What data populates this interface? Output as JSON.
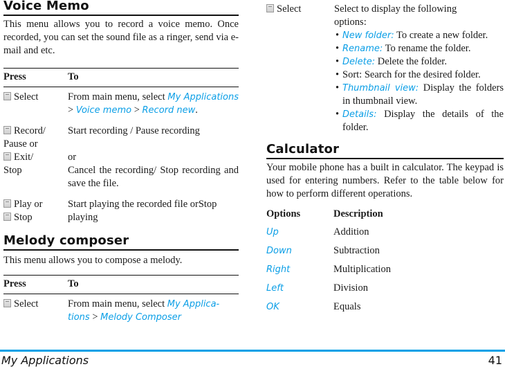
{
  "voice_memo": {
    "title": "Voice Memo",
    "intro": "This menu allows you to record a voice memo. Once recorded, you can set the sound file as a ringer, send via e-mail and etc.",
    "table": {
      "headers": [
        "Press",
        "To"
      ],
      "rows": [
        {
          "press": [
            {
              "key": true,
              "text": "Select"
            }
          ],
          "to": {
            "pre": "From main menu, select ",
            "links": [
              "My Applications",
              "Voice memo",
              "Record new"
            ],
            "sep": " > ",
            "post": "."
          }
        },
        {
          "press_lines": [
            "Record/",
            "Pause or",
            "Exit/",
            "Stop"
          ],
          "to_lines": [
            "Start recording / Pause recording",
            "or",
            "Cancel the recording/ Stop recording and save the file."
          ]
        },
        {
          "press_lines": [
            "Play or",
            "Stop"
          ],
          "to": "Start playing the recorded file orStop playing"
        }
      ]
    }
  },
  "melody_composer": {
    "title": "Melody composer",
    "intro": "This menu allows you to compose a melody.",
    "table": {
      "headers": [
        "Press",
        "To"
      ],
      "rows": [
        {
          "press": "Select",
          "to": {
            "pre": "From main menu, select ",
            "links": [
              "My Applica-tions",
              "Melody Composer"
            ],
            "sep": " > "
          }
        }
      ]
    }
  },
  "folder_options": {
    "press": "Select",
    "intro": "Select to display the following options:",
    "items": [
      {
        "label": "New folder:",
        "text": " To create a new folder.",
        "link": true
      },
      {
        "label": "Rename:",
        "text": " To rename the folder.",
        "link": true
      },
      {
        "label": "Delete:",
        "text": " Delete the folder.",
        "link": true
      },
      {
        "label": "",
        "text": "Sort: Search for the desired folder.",
        "link": false
      },
      {
        "label": "Thumbnail view:",
        "text": " Display the folders in thumbnail view.",
        "link": true
      },
      {
        "label": "Details:",
        "text": " Display the details of the folder.",
        "link": true
      }
    ]
  },
  "calculator": {
    "title": "Calculator",
    "intro": "Your mobile phone has a built in calculator. The keypad is used for entering numbers. Refer to the table below for how to perform different operations.",
    "table": {
      "headers": [
        "Options",
        "Description"
      ],
      "rows": [
        {
          "option": "Up",
          "description": "Addition"
        },
        {
          "option": "Down",
          "description": "Subtraction"
        },
        {
          "option": "Right",
          "description": "Multiplication"
        },
        {
          "option": "Left",
          "description": "Division"
        },
        {
          "option": "OK",
          "description": "Equals"
        }
      ]
    }
  },
  "footer": {
    "section": "My Applications",
    "page_number": "41",
    "accent_color": "#00a0e6"
  },
  "colors": {
    "link": "#0a9ee6",
    "text": "#1a1a1a"
  }
}
